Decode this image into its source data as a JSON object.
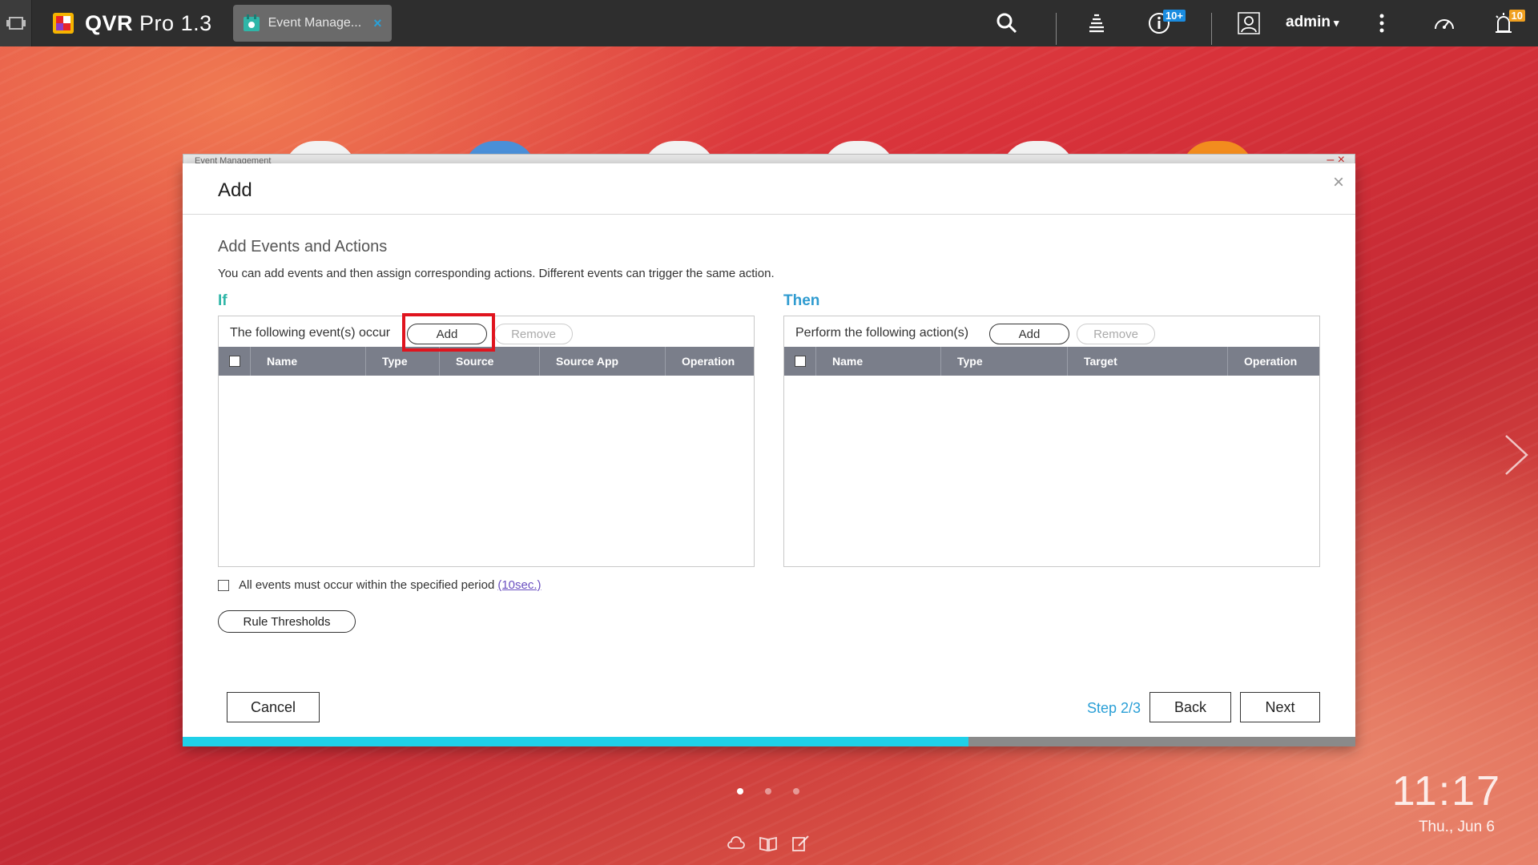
{
  "topbar": {
    "app_name": "QVR",
    "app_name_light": "Pro",
    "app_version": "1.3",
    "task_tab_label": "Event Manage...",
    "task_tab_close": "×",
    "info_badge": "10+",
    "alert_badge": "10",
    "user_name": "admin",
    "user_caret": "▾"
  },
  "behind_window": {
    "title": "Event Management",
    "controls": "– ×"
  },
  "dialog": {
    "title": "Add",
    "close_symbol": "×",
    "section_title": "Add Events and Actions",
    "section_desc": "You can add events and then assign corresponding actions. Different events can trigger the same action.",
    "if_panel": {
      "heading": "If",
      "label": "The following event(s) occur",
      "add_label": "Add",
      "remove_label": "Remove",
      "columns": [
        "Name",
        "Type",
        "Source",
        "Source App",
        "Operation"
      ]
    },
    "then_panel": {
      "heading": "Then",
      "label": "Perform the following action(s)",
      "add_label": "Add",
      "remove_label": "Remove",
      "columns": [
        "Name",
        "Type",
        "Target",
        "Operation"
      ]
    },
    "period_text": "All events must occur within the specified period",
    "period_link": "(10sec.)",
    "thresholds_label": "Rule Thresholds",
    "cancel_label": "Cancel",
    "step_label": "Step 2/3",
    "back_label": "Back",
    "next_label": "Next",
    "progress_fraction": 0.67
  },
  "desktop": {
    "time": "11:17",
    "date": "Thu., Jun 6",
    "pages": 3,
    "active_page": 1
  },
  "colors": {
    "topbar": "#2e2e2e",
    "if_heading": "#2fb6a8",
    "then_heading": "#2f9bd0",
    "table_header": "#7a7e8a",
    "highlight": "#e0141e",
    "progress": "#1fd0e8",
    "step": "#2a9fd6"
  }
}
